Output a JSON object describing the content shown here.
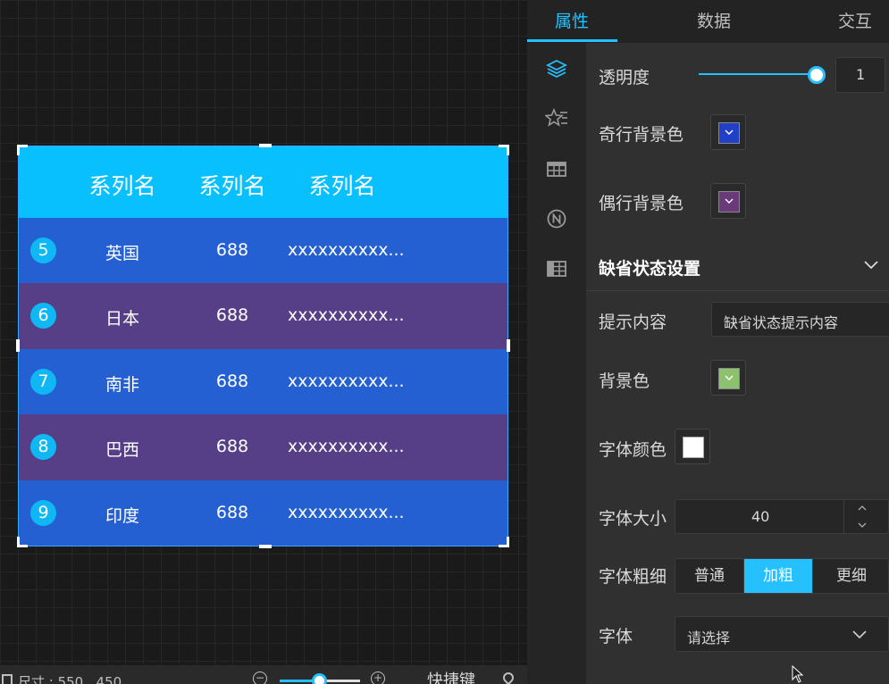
{
  "table": {
    "headers": [
      "系列名",
      "系列名",
      "系列名"
    ],
    "rows": [
      {
        "index": "5",
        "name": "英国",
        "value": "688",
        "detail": "xxxxxxxxxx...",
        "color": "#2460d2"
      },
      {
        "index": "6",
        "name": "日本",
        "value": "688",
        "detail": "xxxxxxxxxx...",
        "color": "#563f86"
      },
      {
        "index": "7",
        "name": "南非",
        "value": "688",
        "detail": "xxxxxxxxxx...",
        "color": "#2460d2"
      },
      {
        "index": "8",
        "name": "巴西",
        "value": "688",
        "detail": "xxxxxxxxxx...",
        "color": "#563f86"
      },
      {
        "index": "9",
        "name": "印度",
        "value": "688",
        "detail": "xxxxxxxxxx...",
        "color": "#2460d2"
      }
    ],
    "header_color": "#09c0ff"
  },
  "bottom_bar": {
    "size_text": "尺寸 : 550 , 450",
    "shortcut_label": "快捷键"
  },
  "tabs": [
    {
      "label": "属性",
      "active": true
    },
    {
      "label": "数据",
      "active": false
    },
    {
      "label": "交互",
      "active": false
    }
  ],
  "sidebar_icons": [
    "layers-icon",
    "star-list-icon",
    "table-icon",
    "n-circle-icon",
    "grid-list-icon"
  ],
  "props": {
    "opacity": {
      "label": "透明度",
      "value": "1",
      "level": 1.0
    },
    "odd_bg": {
      "label": "奇行背景色",
      "color": "#2040c8"
    },
    "even_bg": {
      "label": "偶行背景色",
      "color": "#6a3a7a"
    },
    "default_section": {
      "title": "缺省状态设置"
    },
    "hint": {
      "label": "提示内容",
      "value": "缺省状态提示内容"
    },
    "bg_color": {
      "label": "背景色",
      "color": "#8cc26e"
    },
    "font_color": {
      "label": "字体颜色",
      "color": "#ffffff"
    },
    "font_size": {
      "label": "字体大小",
      "value": "40"
    },
    "font_weight": {
      "label": "字体粗细",
      "options": [
        "普通",
        "加粗",
        "更细"
      ],
      "selected": "加粗"
    },
    "font_family": {
      "label": "字体",
      "placeholder": "请选择"
    }
  },
  "accent_color": "#26c0ff"
}
